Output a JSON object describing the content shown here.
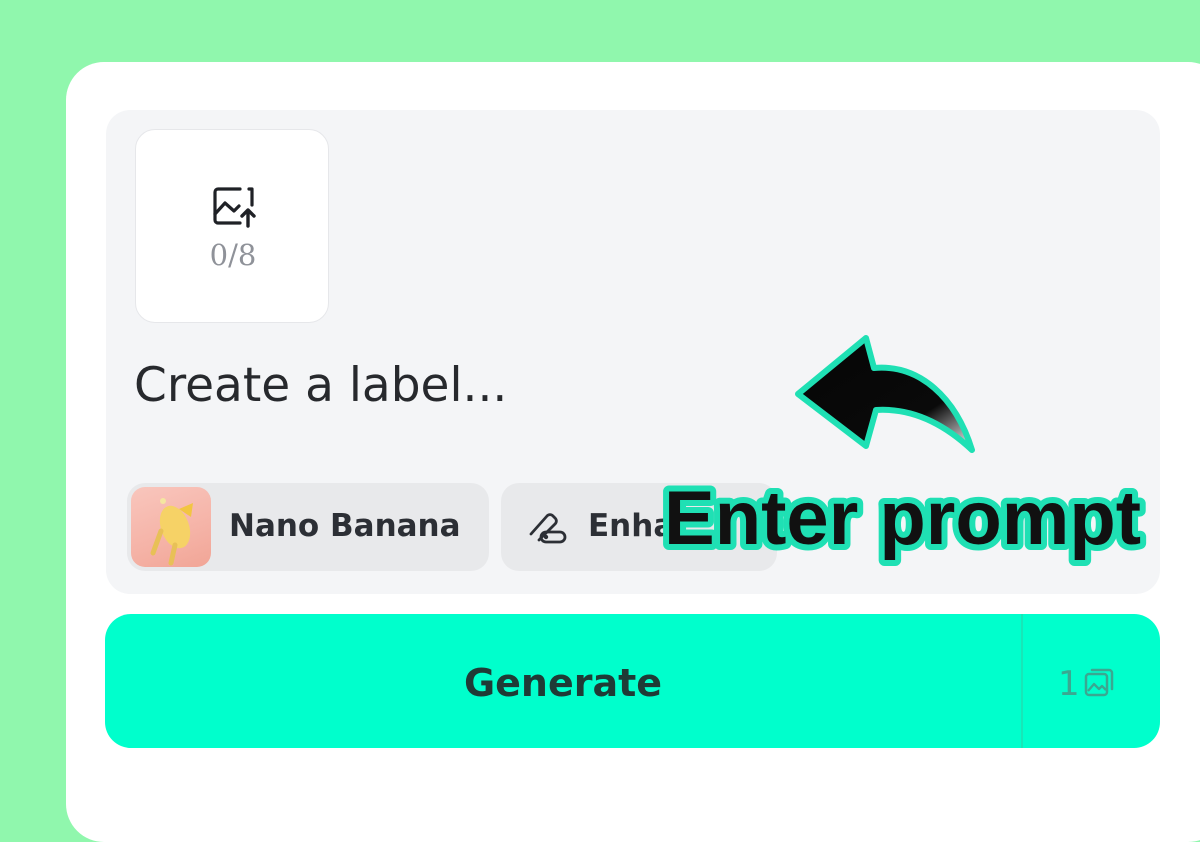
{
  "uploader": {
    "count": "0/8",
    "icon": "image-upload-icon"
  },
  "prompt": {
    "placeholder": "Create a label..."
  },
  "model_chip": {
    "label": "Nano Banana",
    "thumbnail": "nano-banana-thumbnail"
  },
  "enhance_chip": {
    "label": "Enha",
    "icon": "magic-wand-icon"
  },
  "generate": {
    "label": "Generate",
    "count": "1",
    "count_icon": "image-stack-icon"
  },
  "annotation": {
    "text": "Enter prompt"
  },
  "colors": {
    "background": "#90f7ad",
    "accent": "#00ffcc",
    "annotation_outline": "#1fe0b4"
  }
}
